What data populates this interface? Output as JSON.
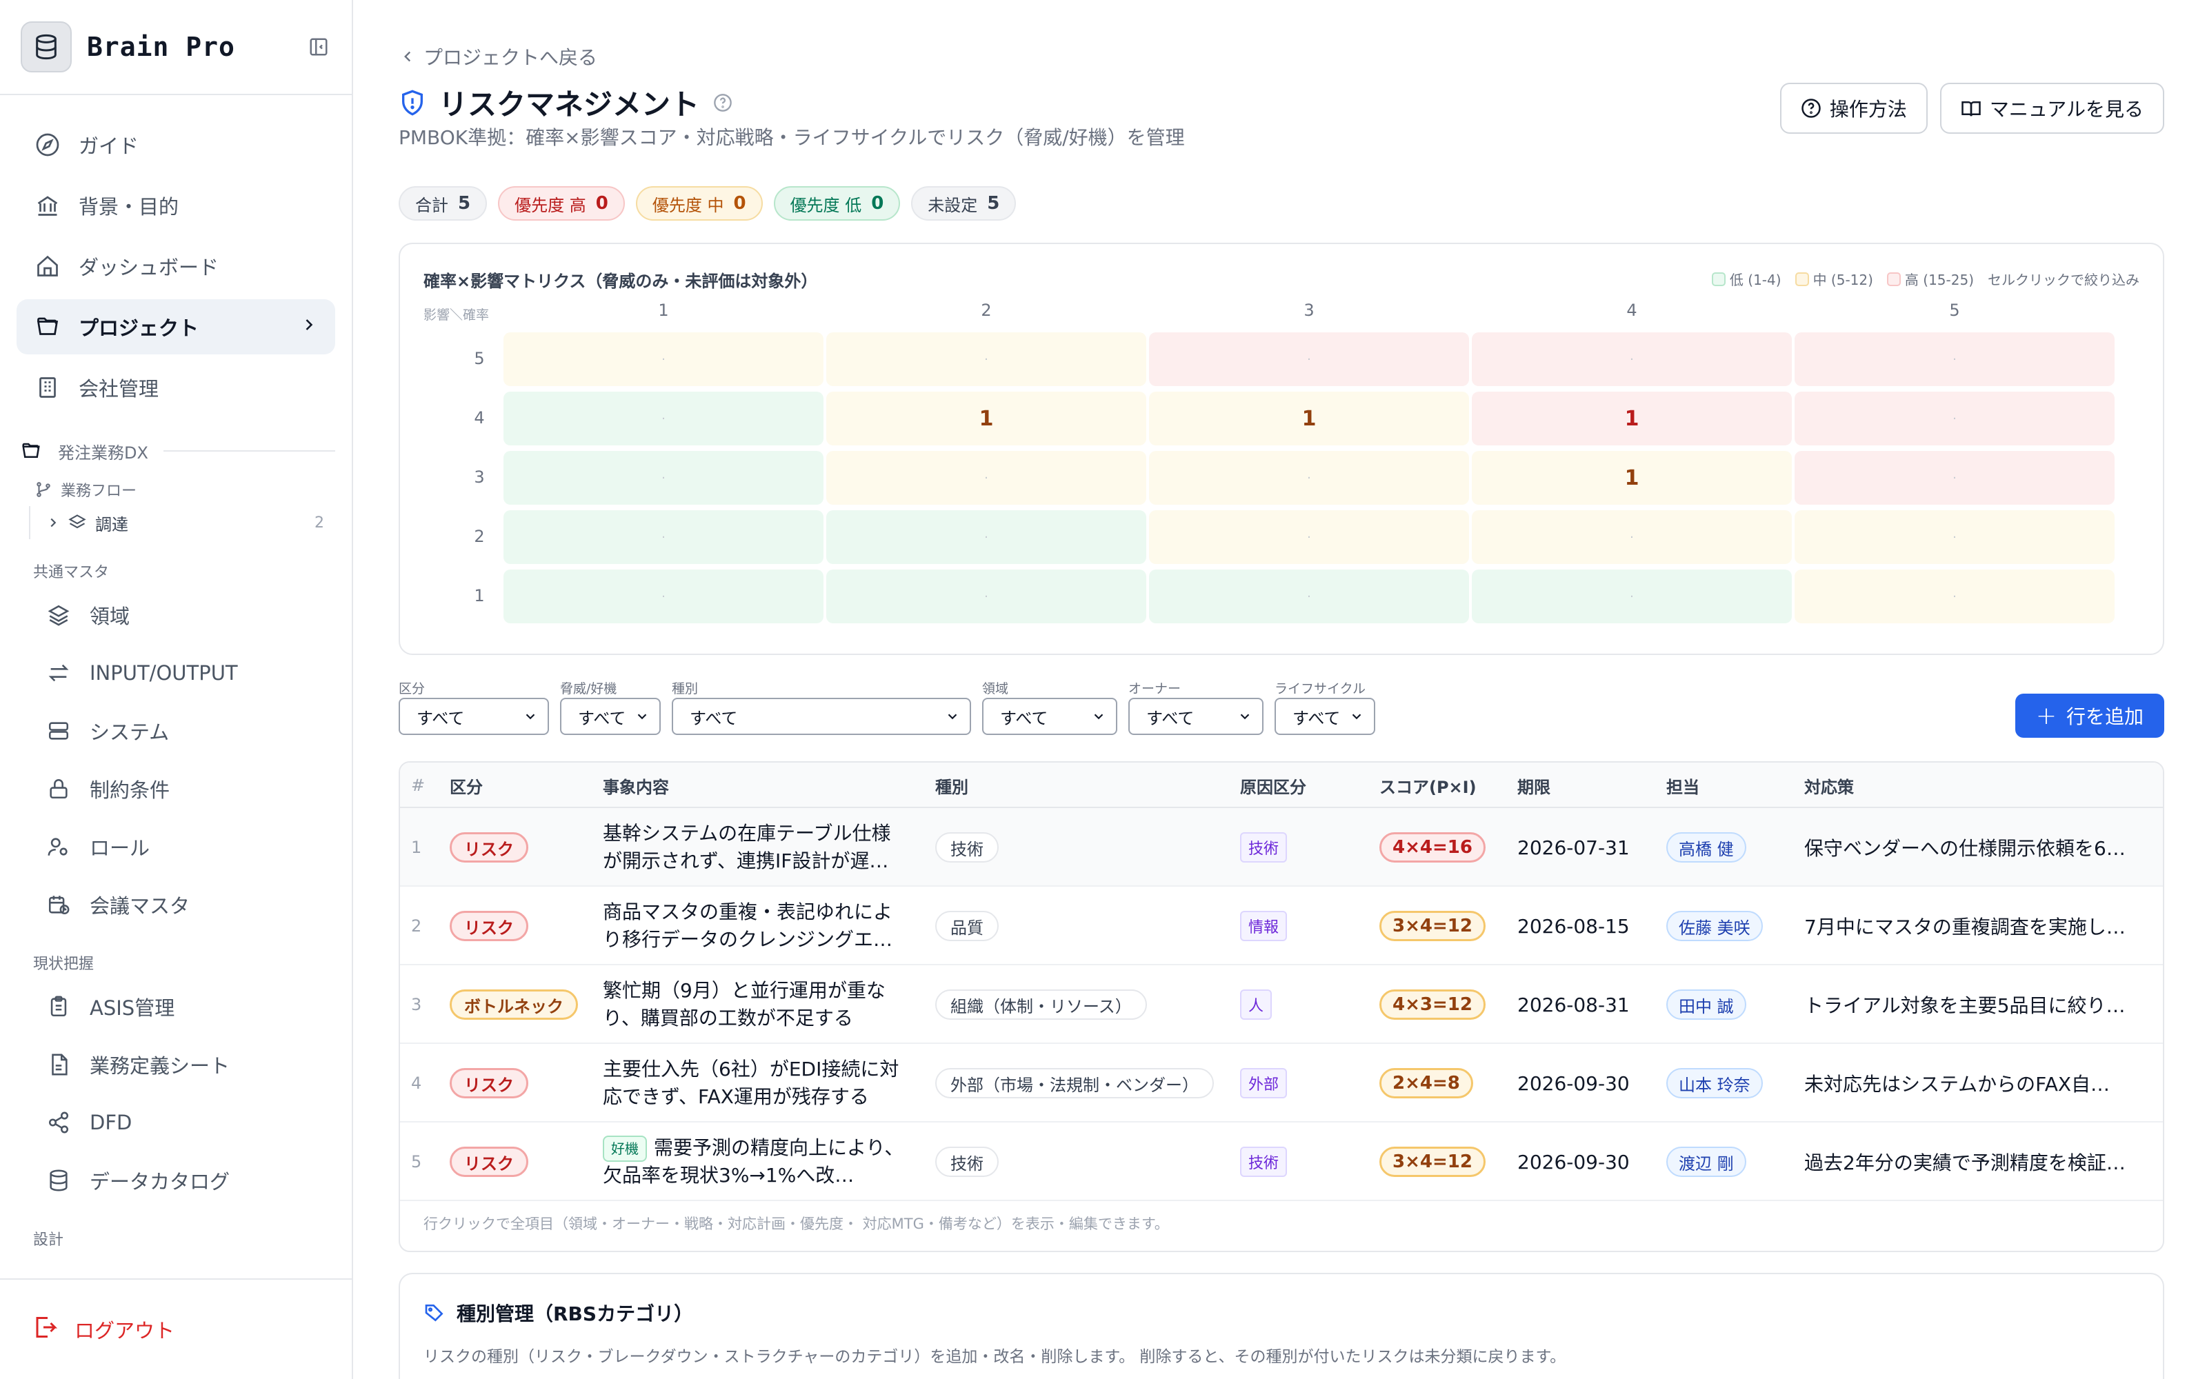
{
  "app": {
    "name": "Brain Pro"
  },
  "sidebar": {
    "main_items": [
      {
        "label": "ガイド",
        "icon": "compass-icon"
      },
      {
        "label": "背景・目的",
        "icon": "bank-icon"
      },
      {
        "label": "ダッシュボード",
        "icon": "home-icon"
      },
      {
        "label": "プロジェクト",
        "icon": "folder-open-icon",
        "active": true
      },
      {
        "label": "会社管理",
        "icon": "building-icon"
      }
    ],
    "project_section": "発注業務DX",
    "flow_label": "業務フロー",
    "flow_items": [
      {
        "label": "調達",
        "count": "2"
      }
    ],
    "groups": [
      {
        "label": "共通マスタ",
        "items": [
          {
            "label": "領域",
            "icon": "layers-icon"
          },
          {
            "label": "INPUT/OUTPUT",
            "icon": "arrows-left-right-icon"
          },
          {
            "label": "システム",
            "icon": "server-icon"
          },
          {
            "label": "制約条件",
            "icon": "lock-icon"
          },
          {
            "label": "ロール",
            "icon": "user-cog-icon"
          },
          {
            "label": "会議マスタ",
            "icon": "calendar-clock-icon"
          }
        ]
      },
      {
        "label": "現状把握",
        "items": [
          {
            "label": "ASIS管理",
            "icon": "clipboard-icon"
          },
          {
            "label": "業務定義シート",
            "icon": "file-icon"
          },
          {
            "label": "DFD",
            "icon": "share-nodes-icon"
          },
          {
            "label": "データカタログ",
            "icon": "database-icon"
          }
        ]
      },
      {
        "label": "設計",
        "items": []
      }
    ],
    "logout_label": "ログアウト"
  },
  "header": {
    "back_label": "プロジェクトへ戻る",
    "title": "リスクマネジメント",
    "subtitle": "PMBOK準拠：確率×影響スコア・対応戦略・ライフサイクルでリスク（脅威/好機）を管理",
    "help_button": "操作方法",
    "manual_button": "マニュアルを見る"
  },
  "summary": {
    "total_label": "合計",
    "total": "5",
    "high_label": "優先度 高",
    "high": "0",
    "mid_label": "優先度 中",
    "mid": "0",
    "low_label": "優先度 低",
    "low": "0",
    "unset_label": "未設定",
    "unset": "5"
  },
  "matrix": {
    "title": "確率×影響マトリクス（脅威のみ・未評価は対象外）",
    "axis_label": "影響＼確率",
    "legend_low": "低 (1-4)",
    "legend_mid": "中 (5-12)",
    "legend_high": "高 (15-25)",
    "legend_hint": "セルクリックで絞り込み",
    "columns": [
      "1",
      "2",
      "3",
      "4",
      "5"
    ],
    "rows": [
      {
        "label": "5",
        "cells": [
          "·",
          "·",
          "·",
          "·",
          "·"
        ]
      },
      {
        "label": "4",
        "cells": [
          "·",
          "1",
          "1",
          "1",
          "·"
        ]
      },
      {
        "label": "3",
        "cells": [
          "·",
          "·",
          "·",
          "1",
          "·"
        ]
      },
      {
        "label": "2",
        "cells": [
          "·",
          "·",
          "·",
          "·",
          "·"
        ]
      },
      {
        "label": "1",
        "cells": [
          "·",
          "·",
          "·",
          "·",
          "·"
        ]
      }
    ]
  },
  "filters": {
    "category": {
      "label": "区分",
      "value": "すべて"
    },
    "threat_opp": {
      "label": "脅威/好機",
      "value": "すべて"
    },
    "type": {
      "label": "種別",
      "value": "すべて"
    },
    "domain": {
      "label": "領域",
      "value": "すべて"
    },
    "owner": {
      "label": "オーナー",
      "value": "すべて"
    },
    "lifecycle": {
      "label": "ライフサイクル",
      "value": "すべて"
    },
    "add_row_label": "行を追加"
  },
  "table": {
    "headers": {
      "idx": "#",
      "category": "区分",
      "description": "事象内容",
      "type": "種別",
      "cause": "原因区分",
      "score": "スコア(P×I)",
      "due": "期限",
      "owner": "担当",
      "measure": "対応策"
    },
    "rows": [
      {
        "idx": "1",
        "category": "リスク",
        "description": "基幹システムの在庫テーブル仕様が開示されず、連携IF設計が遅…",
        "type": "技術",
        "cause": "技術",
        "score": "4×4=16",
        "due": "2026-07-31",
        "owner": "高橋 健",
        "measure": "保守ベンダーへの仕様開示依頼を6…"
      },
      {
        "idx": "2",
        "category": "リスク",
        "description": "商品マスタの重複・表記ゆれにより移行データのクレンジングエ…",
        "type": "品質",
        "cause": "情報",
        "score": "3×4=12",
        "due": "2026-08-15",
        "owner": "佐藤 美咲",
        "measure": "7月中にマスタの重複調査を実施し…"
      },
      {
        "idx": "3",
        "category": "ボトルネック",
        "description": "繁忙期（9月）と並行運用が重なり、購買部の工数が不足する",
        "type": "組織（体制・リソース）",
        "cause": "人",
        "score": "4×3=12",
        "due": "2026-08-31",
        "owner": "田中 誠",
        "measure": "トライアル対象を主要5品目に絞り…"
      },
      {
        "idx": "4",
        "category": "リスク",
        "description": "主要仕入先（6社）がEDI接続に対応できず、FAX運用が残存する",
        "type": "外部（市場・法規制・ベンダー）",
        "cause": "外部",
        "score": "2×4=8",
        "due": "2026-09-30",
        "owner": "山本 玲奈",
        "measure": "未対応先はシステムからのFAX自…"
      },
      {
        "idx": "5",
        "category": "リスク",
        "opportunity_tag": "好機",
        "description": "需要予測の精度向上により、欠品率を現状3%→1%へ改…",
        "type": "技術",
        "cause": "技術",
        "score": "3×4=12",
        "due": "2026-09-30",
        "owner": "渡辺 剛",
        "measure": "過去2年分の実績で予測精度を検証…"
      }
    ],
    "footer": "行クリックで全項目（領域・オーナー・戦略・対応計画・優先度・ 対応MTG・備考など）を表示・編集できます。"
  },
  "category_mgmt": {
    "title": "種別管理（RBSカテゴリ）",
    "description": "リスクの種別（リスク・ブレークダウン・ストラクチャーのカテゴリ）を追加・改名・削除します。 削除すると、その種別が付いたリスクは未分類に戻ります。"
  },
  "colors": {
    "accent": "#2563eb",
    "danger": "#dc2626",
    "low": "#ebf9f1",
    "mid": "#fefaec",
    "high": "#fdeeee"
  }
}
